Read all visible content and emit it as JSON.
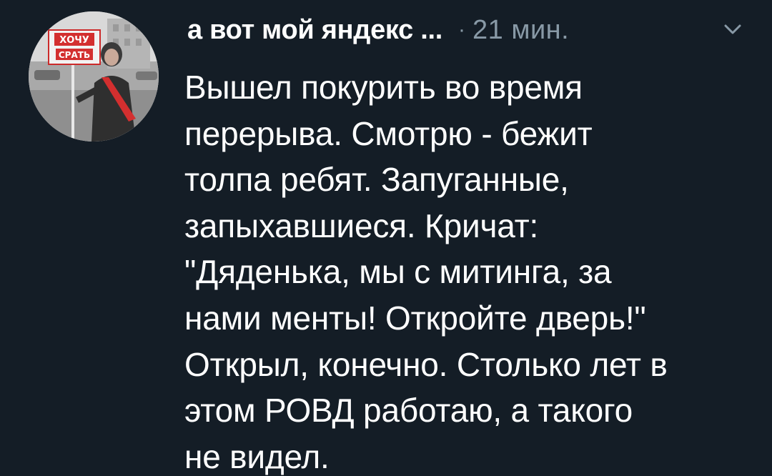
{
  "tweet": {
    "author_name": "а вот мой яндекс ...",
    "separator": "·",
    "timestamp": "21 мин.",
    "menu_icon": "chevron-down-icon",
    "avatar": {
      "description_icon": "avatar-photo",
      "sign_text": "ХОЧУ СРАТЬ"
    },
    "body_lines": [
      "Вышел покурить во время",
      "перерыва. Смотрю - бежит",
      "толпа ребят. Запуганные,",
      "запыхавшиеся. Кричат:",
      "\"Дяденька, мы с митинга, за",
      "нами менты! Откройте дверь!\"",
      "Открыл, конечно. Столько лет в",
      "этом РОВД работаю, а такого",
      "не видел."
    ]
  },
  "colors": {
    "background": "#141d26",
    "text_primary": "#ffffff",
    "text_secondary": "#8899a6"
  }
}
